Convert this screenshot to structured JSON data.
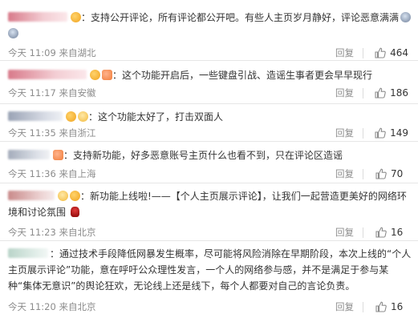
{
  "ui": {
    "reply_label": "回复"
  },
  "comments": [
    {
      "user": "",
      "text": "：支持公开评论，所有评论都公开吧。有些人主页岁月静好，评论恶意满满",
      "time": "今天 11:09 来自湖北",
      "likes": "464"
    },
    {
      "user": "",
      "text": "：这个功能开启后，一些键盘引战、造谣生事者更会早早现行",
      "time": "今天 11:17 来自安徽",
      "likes": "186"
    },
    {
      "user": "",
      "text": "：这个功能太好了，打击双面人",
      "time": "今天 11:35 来自浙江",
      "likes": "149"
    },
    {
      "user": "",
      "text": "：支持新功能，好多恶意账号主页什么也看不到，只在评论区造谣",
      "time": "今天 11:36 来自上海",
      "likes": "70"
    },
    {
      "user": "",
      "text": "：新功能上线啦!——【个人主页展示评论】，让我们一起营造更美好的网络环境和讨论氛围",
      "time": "今天 11:23 来自北京",
      "likes": "16"
    },
    {
      "user": "",
      "text": "：通过技术手段降低网暴发生概率，尽可能将风险消除在早期阶段，本次上线的“个人主页展示评论”功能，意在呼吁公众理性发言，一个人的网络参与感，并不是满足于参与某种“集体无意识”的舆论狂欢，无论线上还是线下，每个人都要对自己的言论负责。",
      "time": "今天 11:20 来自北京",
      "likes": "16"
    }
  ]
}
